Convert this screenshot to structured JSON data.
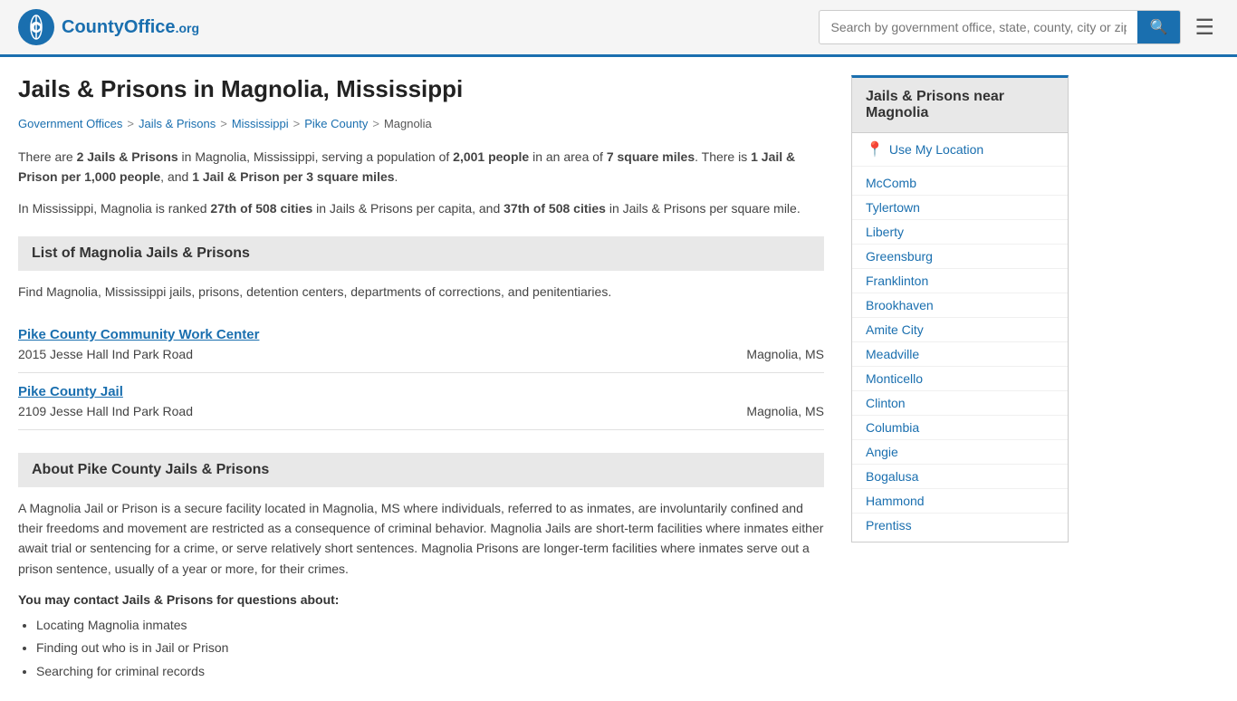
{
  "header": {
    "logo_text": "CountyOffice",
    "logo_org": ".org",
    "search_placeholder": "Search by government office, state, county, city or zip code",
    "search_value": ""
  },
  "page": {
    "title": "Jails & Prisons in Magnolia, Mississippi",
    "breadcrumb": [
      {
        "label": "Government Offices",
        "href": "#"
      },
      {
        "label": "Jails & Prisons",
        "href": "#"
      },
      {
        "label": "Mississippi",
        "href": "#"
      },
      {
        "label": "Pike County",
        "href": "#"
      },
      {
        "label": "Magnolia",
        "href": "#"
      }
    ],
    "intro1": "There are 2 Jails & Prisons in Magnolia, Mississippi, serving a population of 2,001 people in an area of 7 square miles. There is 1 Jail & Prison per 1,000 people, and 1 Jail & Prison per 3 square miles.",
    "intro2": "In Mississippi, Magnolia is ranked 27th of 508 cities in Jails & Prisons per capita, and 37th of 508 cities in Jails & Prisons per square mile.",
    "list_section_title": "List of Magnolia Jails & Prisons",
    "list_desc": "Find Magnolia, Mississippi jails, prisons, detention centers, departments of corrections, and penitentiaries.",
    "facilities": [
      {
        "name": "Pike County Community Work Center",
        "address": "2015 Jesse Hall Ind Park Road",
        "city": "Magnolia, MS"
      },
      {
        "name": "Pike County Jail",
        "address": "2109 Jesse Hall Ind Park Road",
        "city": "Magnolia, MS"
      }
    ],
    "about_section_title": "About Pike County Jails & Prisons",
    "about_text": "A Magnolia Jail or Prison is a secure facility located in Magnolia, MS where individuals, referred to as inmates, are involuntarily confined and their freedoms and movement are restricted as a consequence of criminal behavior. Magnolia Jails are short-term facilities where inmates either await trial or sentencing for a crime, or serve relatively short sentences. Magnolia Prisons are longer-term facilities where inmates serve out a prison sentence, usually of a year or more, for their crimes.",
    "contact_label": "You may contact Jails & Prisons for questions about:",
    "contact_items": [
      "Locating Magnolia inmates",
      "Finding out who is in Jail or Prison",
      "Searching for criminal records"
    ]
  },
  "sidebar": {
    "title": "Jails & Prisons near Magnolia",
    "use_location_label": "Use My Location",
    "nearby_cities": [
      "McComb",
      "Tylertown",
      "Liberty",
      "Greensburg",
      "Franklinton",
      "Brookhaven",
      "Amite City",
      "Meadville",
      "Monticello",
      "Clinton",
      "Columbia",
      "Angie",
      "Bogalusa",
      "Hammond",
      "Prentiss"
    ]
  }
}
